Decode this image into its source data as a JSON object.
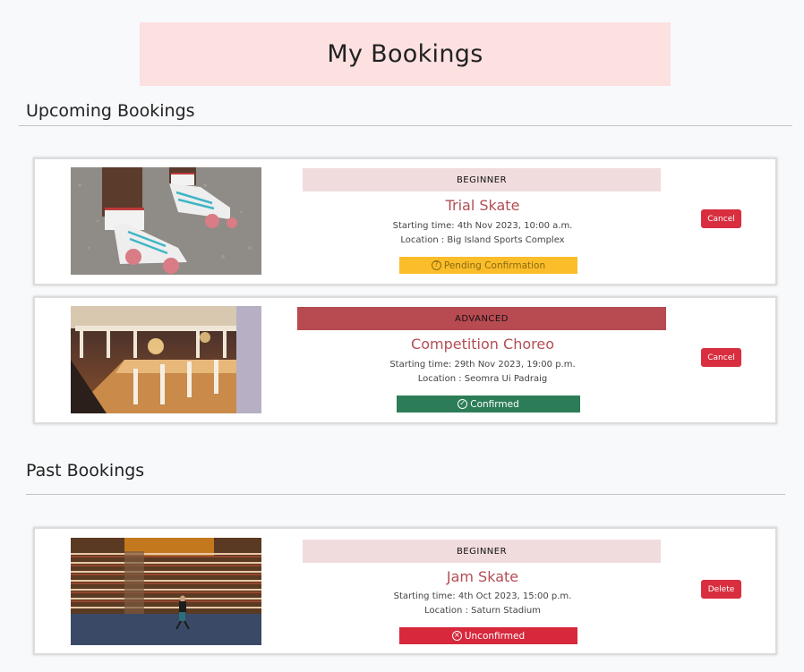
{
  "page": {
    "title": "My Bookings"
  },
  "sections": {
    "upcoming": {
      "heading": "Upcoming Bookings"
    },
    "past": {
      "heading": "Past Bookings"
    }
  },
  "bookings": [
    {
      "level": "BEGINNER",
      "class_name": "Trial Skate",
      "start_time": "Starting time: 4th Nov 2023, 10:00 a.m.",
      "location": "Location : Big Island Sports Complex",
      "status": "Pending Confirmation",
      "status_icon": "question-circle-icon",
      "action": "Cancel",
      "image": "roller-skates-photo"
    },
    {
      "level": "ADVANCED",
      "class_name": "Competition Choreo",
      "start_time": "Starting time: 29th Nov 2023, 19:00 p.m.",
      "location": "Location : Seomra Ui Padraig",
      "status": "Confirmed",
      "status_icon": "check-circle-icon",
      "action": "Cancel",
      "image": "ballroom-interior-photo"
    },
    {
      "level": "BEGINNER",
      "class_name": "Jam Skate",
      "start_time": "Starting time: 4th Oct 2023, 15:00 p.m.",
      "location": "Location : Saturn Stadium",
      "status": "Unconfirmed",
      "status_icon": "x-circle-icon",
      "action": "Delete",
      "image": "stadium-skater-photo"
    }
  ],
  "colors": {
    "title_bg": "#fde0e0",
    "beginner_bg": "#f1dcdd",
    "advanced_bg": "#b84a52",
    "class_title": "#b34d55",
    "pending": "#fbbd2a",
    "confirmed": "#2c7d57",
    "unconfirmed": "#d7283c",
    "button": "#d82e3f"
  }
}
